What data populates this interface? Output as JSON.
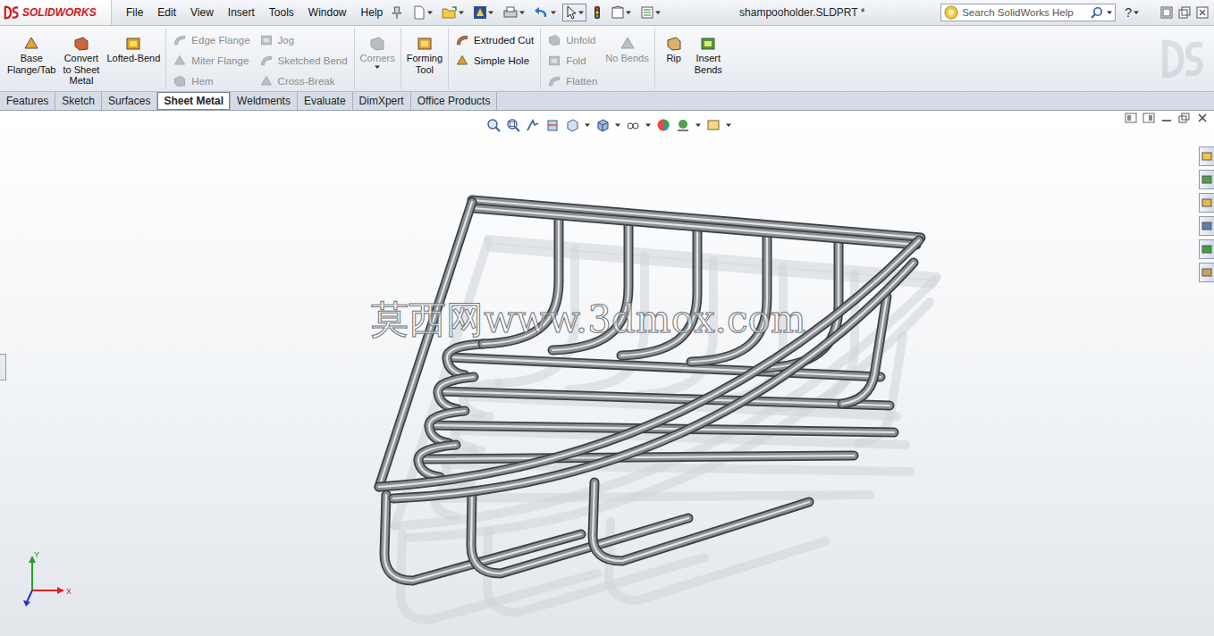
{
  "window": {
    "title": "shampooholder.SLDPRT *"
  },
  "logo": {
    "text": "SOLIDWORKS"
  },
  "menu": [
    "File",
    "Edit",
    "View",
    "Insert",
    "Tools",
    "Window",
    "Help"
  ],
  "search": {
    "placeholder": "Search SolidWorks Help"
  },
  "help": {
    "label": "?"
  },
  "ribbon": [
    {
      "items": [
        {
          "kind": "large",
          "lines": [
            "Base",
            "Flange/Tab"
          ],
          "disabled": false,
          "dropdown": false
        },
        {
          "kind": "large",
          "lines": [
            "Convert",
            "to Sheet",
            "Metal"
          ],
          "disabled": false,
          "dropdown": false
        },
        {
          "kind": "large",
          "lines": [
            "Lofted-Bend"
          ],
          "disabled": false,
          "dropdown": false
        }
      ]
    },
    {
      "items": [
        {
          "kind": "column",
          "entries": [
            {
              "label": "Edge Flange",
              "disabled": true
            },
            {
              "label": "Miter Flange",
              "disabled": true
            },
            {
              "label": "Hem",
              "disabled": true
            }
          ]
        },
        {
          "kind": "column",
          "entries": [
            {
              "label": "Jog",
              "disabled": true
            },
            {
              "label": "Sketched Bend",
              "disabled": true
            },
            {
              "label": "Cross-Break",
              "disabled": true
            }
          ]
        }
      ]
    },
    {
      "items": [
        {
          "kind": "large",
          "lines": [
            "Corners"
          ],
          "disabled": true,
          "dropdown": true
        }
      ]
    },
    {
      "items": [
        {
          "kind": "large",
          "lines": [
            "Forming",
            "Tool"
          ],
          "disabled": false,
          "dropdown": false
        }
      ]
    },
    {
      "items": [
        {
          "kind": "column",
          "entries": [
            {
              "label": "Extruded Cut",
              "disabled": false
            },
            {
              "label": "Simple Hole",
              "disabled": false
            }
          ]
        }
      ]
    },
    {
      "items": [
        {
          "kind": "column",
          "entries": [
            {
              "label": "Unfold",
              "disabled": true
            },
            {
              "label": "Fold",
              "disabled": true
            },
            {
              "label": "Flatten",
              "disabled": true
            }
          ]
        },
        {
          "kind": "large",
          "lines": [
            "No Bends"
          ],
          "disabled": true,
          "dropdown": false
        }
      ]
    },
    {
      "items": [
        {
          "kind": "large",
          "lines": [
            "Rip"
          ],
          "disabled": false,
          "dropdown": false
        },
        {
          "kind": "large",
          "lines": [
            "Insert",
            "Bends"
          ],
          "disabled": false,
          "dropdown": false
        }
      ]
    }
  ],
  "tabs": [
    {
      "label": "Features",
      "selected": false
    },
    {
      "label": "Sketch",
      "selected": false
    },
    {
      "label": "Surfaces",
      "selected": false
    },
    {
      "label": "Sheet Metal",
      "selected": true
    },
    {
      "label": "Weldments",
      "selected": false
    },
    {
      "label": "Evaluate",
      "selected": false
    },
    {
      "label": "DimXpert",
      "selected": false
    },
    {
      "label": "Office Products",
      "selected": false
    }
  ],
  "watermark": "莫西网www.3dmox.com",
  "triad": {
    "x": "X",
    "y": "Y"
  }
}
